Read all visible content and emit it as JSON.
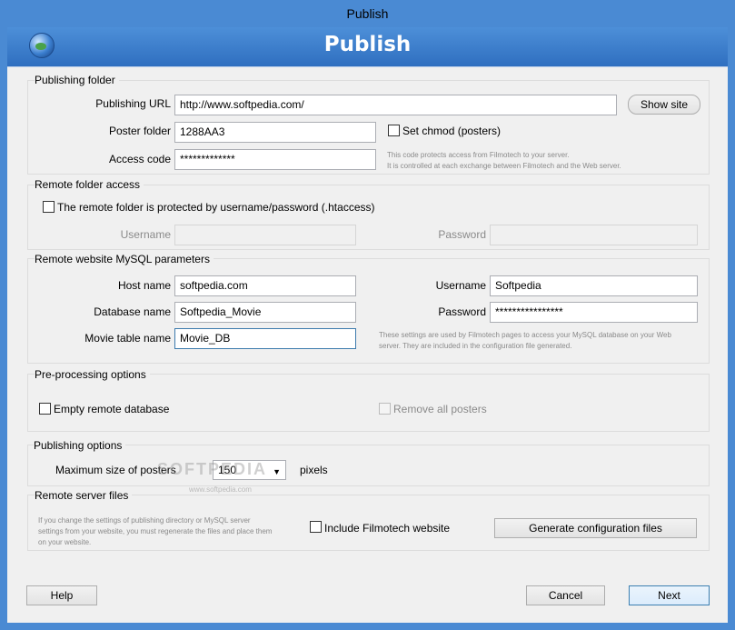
{
  "window": {
    "title": "Publish"
  },
  "banner": {
    "title": "Publish",
    "icon": "globe-icon"
  },
  "publishing_folder": {
    "title": "Publishing folder",
    "url_label": "Publishing URL",
    "url_value": "http://www.softpedia.com/",
    "show_site_label": "Show site",
    "poster_folder_label": "Poster folder",
    "poster_folder_value": "1288AA3",
    "chmod_label": "Set chmod (posters)",
    "access_code_label": "Access code",
    "access_code_value": "*************",
    "note_line1": "This code protects access from Filmotech to your server.",
    "note_line2": "It is controlled at each exchange between Filmotech and the Web server."
  },
  "remote_folder": {
    "title": "Remote folder access",
    "protected_label": "The remote folder is protected by username/password (.htaccess)",
    "username_label": "Username",
    "password_label": "Password"
  },
  "mysql": {
    "title": "Remote website MySQL parameters",
    "host_label": "Host name",
    "host_value": "softpedia.com",
    "database_label": "Database name",
    "database_value": "Softpedia_Movie",
    "table_label": "Movie table name",
    "table_value": "Movie_DB",
    "username_label": "Username",
    "username_value": "Softpedia",
    "password_label": "Password",
    "password_value": "****************",
    "note_line1": "These settings are used by Filmotech pages to access your MySQL database on your Web",
    "note_line2": "server. They are included in the configuration file generated."
  },
  "preprocessing": {
    "title": "Pre-processing options",
    "empty_db_label": "Empty remote database",
    "remove_posters_label": "Remove all posters"
  },
  "publishing_options": {
    "title": "Publishing options",
    "max_size_label": "Maximum size of posters",
    "max_size_value": "150",
    "unit_label": "pixels"
  },
  "remote_server_files": {
    "title": "Remote server files",
    "note_line1": "If you change the settings of publishing directory or MySQL server",
    "note_line2": "settings from your website, you must regenerate the files and place them",
    "note_line3": "on your website.",
    "include_label": "Include Filmotech website",
    "generate_label": "Generate configuration files"
  },
  "footer": {
    "help_label": "Help",
    "cancel_label": "Cancel",
    "next_label": "Next"
  },
  "watermark": {
    "text": "SOFTPEDIA",
    "url": "www.softpedia.com"
  }
}
